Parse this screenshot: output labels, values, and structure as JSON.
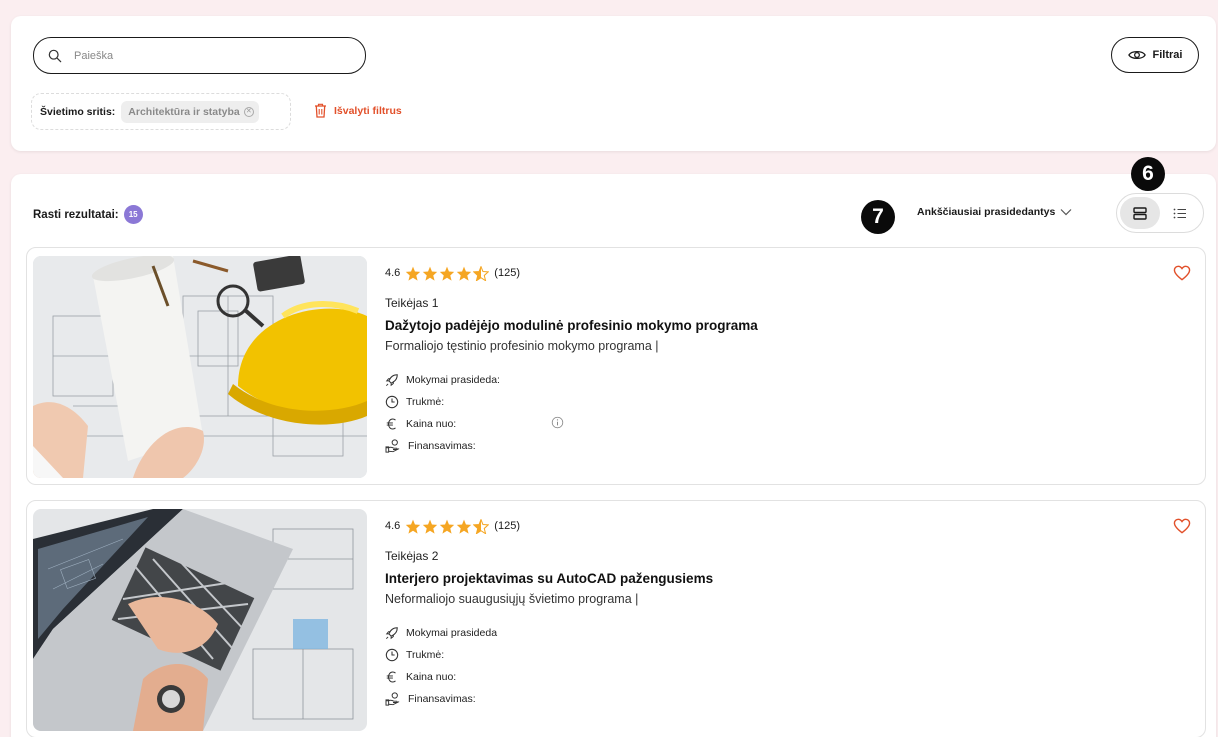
{
  "search": {
    "placeholder": "Paieška",
    "value": ""
  },
  "filters_button": {
    "label": "Filtrai",
    "icon": "eye-icon"
  },
  "active_filter": {
    "label": "Švietimo sritis:",
    "value": "Architektūra ir statyba",
    "remove_icon": "close-circle-icon"
  },
  "clear_filters": {
    "label": "Išvalyti filtrus",
    "icon": "trash-icon",
    "color": "#e2502a"
  },
  "results": {
    "label": "Rasti rezultatai:",
    "count": "15",
    "badge_color": "#8b78d6"
  },
  "annotations": {
    "step_6": "6",
    "step_7": "7"
  },
  "sort": {
    "label": "Ankščiausiai prasidedantys",
    "icon": "chevron-down-icon"
  },
  "view_toggle": {
    "options": [
      {
        "name": "card-view",
        "icon": "card-view-icon",
        "active": true
      },
      {
        "name": "list-view",
        "icon": "list-view-icon",
        "active": false
      }
    ]
  },
  "cards": [
    {
      "rating": "4.6",
      "stars": 4.5,
      "reviews": "(125)",
      "provider": "Teikėjas 1",
      "title": "Dažytojo padėjėjo modulinė profesinio mokymo programa",
      "type": "Formaliojo tęstinio profesinio mokymo programa |",
      "meta": {
        "start": "Mokymai prasideda:",
        "duration": "Trukmė:",
        "price": "Kaina nuo:",
        "funding": "Finansavimas:"
      }
    },
    {
      "rating": "4.6",
      "stars": 4.5,
      "reviews": "(125)",
      "provider": "Teikėjas 2",
      "title": "Interjero projektavimas su AutoCAD pažengusiems",
      "type": "Neformaliojo suaugusiųjų švietimo programa |",
      "meta": {
        "start": "Mokymai prasideda",
        "duration": "Trukmė:",
        "price": "Kaina nuo:",
        "funding": "Finansavimas:"
      }
    }
  ],
  "colors": {
    "star": "#f5a623",
    "heart": "#e2502a",
    "accent": "#8b78d6"
  }
}
